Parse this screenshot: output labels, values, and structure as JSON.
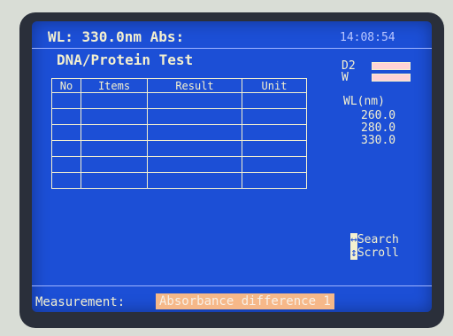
{
  "header": {
    "wl_readout": "WL: 330.0nm Abs:",
    "time": "14:08:54"
  },
  "title": "DNA/Protein Test",
  "lamps": {
    "d2_label": "D2",
    "w_label": "W"
  },
  "wavelengths": {
    "label": "WL(nm)",
    "values": [
      "260.0",
      "280.0",
      "330.0"
    ]
  },
  "table": {
    "headers": [
      "No",
      "Items",
      "Result",
      "Unit"
    ],
    "row_count": 6
  },
  "hints": {
    "search": "Search",
    "scroll": "Scroll"
  },
  "status": {
    "label": "Measurement:",
    "value": "Absorbance difference 1"
  },
  "colors": {
    "screen": "#1c4fd6",
    "text": "#f4f0cf",
    "highlight": "#f6b889"
  }
}
